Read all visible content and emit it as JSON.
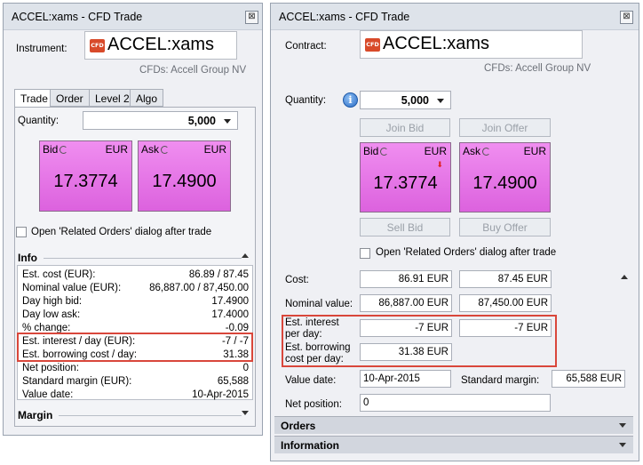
{
  "left": {
    "title": "ACCEL:xams - CFD Trade",
    "close": "⊠",
    "instrument_label": "Instrument:",
    "instrument_name": "ACCEL:xams",
    "logo": "CFD",
    "subtitle": "CFDs: Accell Group NV",
    "tabs": [
      "Trade",
      "Order",
      "Level 2",
      "Algo"
    ],
    "quantity_label": "Quantity:",
    "quantity": "5,000",
    "bid": {
      "side": "Bid",
      "ccy": "EUR",
      "price": "17.3774"
    },
    "ask": {
      "side": "Ask",
      "ccy": "EUR",
      "price": "17.4900"
    },
    "related_orders": "Open 'Related Orders' dialog after trade",
    "info_header": "Info",
    "info_rows": [
      {
        "k": "Est. cost (EUR):",
        "v": "86.89 / 87.45"
      },
      {
        "k": "Nominal value (EUR):",
        "v": "86,887.00 / 87,450.00"
      },
      {
        "k": "Day high bid:",
        "v": "17.4900"
      },
      {
        "k": "Day low ask:",
        "v": "17.4000"
      },
      {
        "k": "% change:",
        "v": "-0.09"
      },
      {
        "k": "Est. interest / day (EUR):",
        "v": "-7 / -7"
      },
      {
        "k": "Est. borrowing cost / day:",
        "v": "31.38"
      },
      {
        "k": "Net position:",
        "v": "0"
      },
      {
        "k": "Standard margin (EUR):",
        "v": "65,588"
      },
      {
        "k": "Value date:",
        "v": "10-Apr-2015"
      }
    ],
    "margin_header": "Margin"
  },
  "right": {
    "title": "ACCEL:xams - CFD Trade",
    "close": "⊠",
    "contract_label": "Contract:",
    "instrument_name": "ACCEL:xams",
    "logo": "CFD",
    "subtitle": "CFDs: Accell Group NV",
    "quantity_label": "Quantity:",
    "info_icon": "i",
    "quantity": "5,000",
    "join_bid": "Join Bid",
    "join_offer": "Join Offer",
    "bid": {
      "side": "Bid",
      "ccy": "EUR",
      "price": "17.3774",
      "arrow": "⬇"
    },
    "ask": {
      "side": "Ask",
      "ccy": "EUR",
      "price": "17.4900"
    },
    "sell_bid": "Sell Bid",
    "buy_offer": "Buy Offer",
    "related_orders": "Open 'Related Orders' dialog after trade",
    "cost_label": "Cost:",
    "cost_bid": "86.91 EUR",
    "cost_ask": "87.45 EUR",
    "nominal_label": "Nominal value:",
    "nominal_bid": "86,887.00 EUR",
    "nominal_ask": "87,450.00 EUR",
    "interest_label": "Est. interest per day:",
    "interest_bid": "-7 EUR",
    "interest_ask": "-7 EUR",
    "borrow_label": "Est. borrowing cost per day:",
    "borrow_value": "31.38 EUR",
    "value_date_label": "Value date:",
    "value_date": "10-Apr-2015",
    "std_margin_label": "Standard margin:",
    "std_margin": "65,588 EUR",
    "net_pos_label": "Net position:",
    "net_pos": "0",
    "orders_header": "Orders",
    "information_header": "Information"
  },
  "colors": {
    "highlight": "#d9473b",
    "tile": "#e678e8",
    "logo": "#d84a2a"
  }
}
